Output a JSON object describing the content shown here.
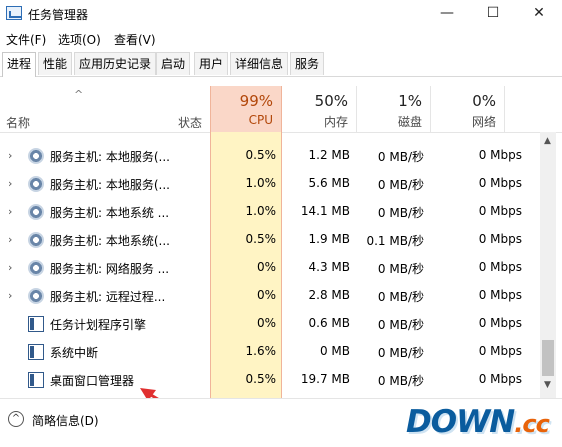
{
  "window": {
    "title": "任务管理器",
    "controls": {
      "minimize": "—",
      "maximize": "☐",
      "close": "✕"
    }
  },
  "menu": [
    "文件(F)",
    "选项(O)",
    "查看(V)"
  ],
  "tabs": [
    "进程",
    "性能",
    "应用历史记录",
    "启动",
    "用户",
    "详细信息",
    "服务"
  ],
  "active_tab": "进程",
  "columns": {
    "name": "名称",
    "status": "状态",
    "cpu": {
      "pct": "99%",
      "label": "CPU"
    },
    "memory": {
      "pct": "50%",
      "label": "内存"
    },
    "disk": {
      "pct": "1%",
      "label": "磁盘"
    },
    "network": {
      "pct": "0%",
      "label": "网络"
    }
  },
  "processes": [
    {
      "name": "服务主机: 本地服务(...",
      "expandable": true,
      "icon": "gear-icon",
      "cpu": "0.5%",
      "memory": "1.2 MB",
      "disk": "0 MB/秒",
      "network": "0 Mbps"
    },
    {
      "name": "服务主机: 本地服务(...",
      "expandable": true,
      "icon": "gear-icon",
      "cpu": "1.0%",
      "memory": "5.6 MB",
      "disk": "0 MB/秒",
      "network": "0 Mbps"
    },
    {
      "name": "服务主机: 本地系统 ...",
      "expandable": true,
      "icon": "gear-icon",
      "cpu": "1.0%",
      "memory": "14.1 MB",
      "disk": "0 MB/秒",
      "network": "0 Mbps"
    },
    {
      "name": "服务主机: 本地系统(...",
      "expandable": true,
      "icon": "gear-icon",
      "cpu": "0.5%",
      "memory": "1.9 MB",
      "disk": "0.1 MB/秒",
      "network": "0 Mbps"
    },
    {
      "name": "服务主机: 网络服务 ...",
      "expandable": true,
      "icon": "gear-icon",
      "cpu": "0%",
      "memory": "4.3 MB",
      "disk": "0 MB/秒",
      "network": "0 Mbps"
    },
    {
      "name": "服务主机: 远程过程...",
      "expandable": true,
      "icon": "gear-icon",
      "cpu": "0%",
      "memory": "2.8 MB",
      "disk": "0 MB/秒",
      "network": "0 Mbps"
    },
    {
      "name": "任务计划程序引擎",
      "expandable": false,
      "icon": "window-icon",
      "cpu": "0%",
      "memory": "0.6 MB",
      "disk": "0 MB/秒",
      "network": "0 Mbps"
    },
    {
      "name": "系统中断",
      "expandable": false,
      "icon": "window-icon",
      "cpu": "1.6%",
      "memory": "0 MB",
      "disk": "0 MB/秒",
      "network": "0 Mbps"
    },
    {
      "name": "桌面窗口管理器",
      "expandable": false,
      "icon": "window-icon",
      "cpu": "0.5%",
      "memory": "19.7 MB",
      "disk": "0 MB/秒",
      "network": "0 Mbps"
    }
  ],
  "footer": {
    "fewer_details": "简略信息(D)"
  },
  "watermark": {
    "main": "DOWN",
    "suffix": ".cc"
  },
  "colors": {
    "cpu_header": "#fad7c8",
    "cpu_column": "#fff4c4",
    "accent": "#0a5c9e",
    "arrow": "#e03030"
  }
}
